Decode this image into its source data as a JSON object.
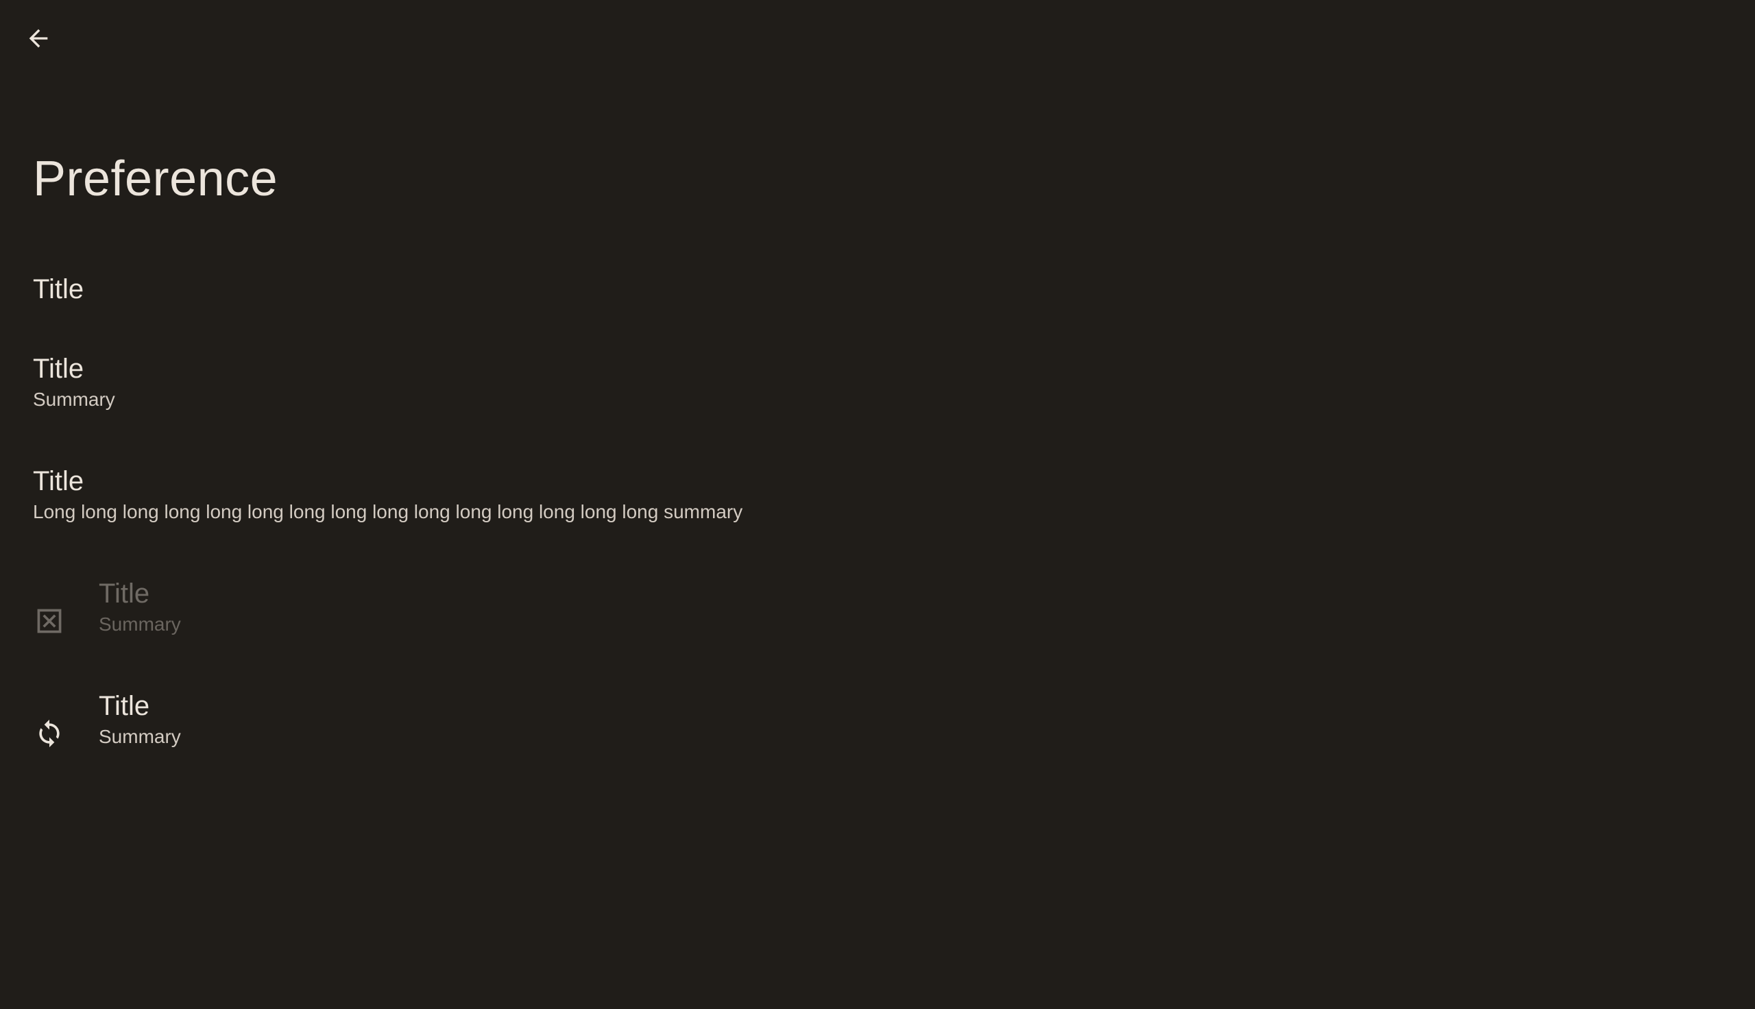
{
  "header": {
    "back_icon": "arrow-back-icon",
    "title": "Preference"
  },
  "preferences": [
    {
      "title": "Title",
      "summary": "",
      "icon": null,
      "enabled": true
    },
    {
      "title": "Title",
      "summary": "Summary",
      "icon": null,
      "enabled": true
    },
    {
      "title": "Title",
      "summary": "Long long long long long long long long long long long long long long long summary",
      "icon": null,
      "enabled": true
    },
    {
      "title": "Title",
      "summary": "Summary",
      "icon": "disabled-box-x-icon",
      "enabled": false
    },
    {
      "title": "Title",
      "summary": "Summary",
      "icon": "sync-icon",
      "enabled": true
    }
  ],
  "colors": {
    "background": "#201d19",
    "text_primary": "#ece5dc",
    "text_secondary": "#d3cbc2",
    "text_disabled": "#6f6a64"
  }
}
